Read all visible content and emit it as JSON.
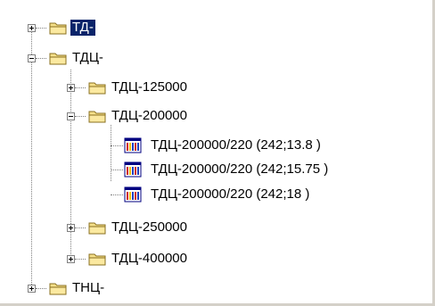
{
  "tree": {
    "items": [
      {
        "label": "ТД-",
        "icon": "folder-icon",
        "expanded": false,
        "selected": true
      },
      {
        "label": "ТДЦ-",
        "icon": "folder-icon",
        "expanded": true
      },
      {
        "label": "ТДЦ-125000",
        "icon": "folder-icon",
        "expanded": false
      },
      {
        "label": "ТДЦ-200000",
        "icon": "folder-icon",
        "expanded": true
      },
      {
        "label": "ТДЦ-200000/220 (242;13.8 )",
        "icon": "table-icon"
      },
      {
        "label": "ТДЦ-200000/220 (242;15.75 )",
        "icon": "table-icon"
      },
      {
        "label": "ТДЦ-200000/220 (242;18 )",
        "icon": "table-icon"
      },
      {
        "label": "ТДЦ-250000",
        "icon": "folder-icon",
        "expanded": false
      },
      {
        "label": "ТДЦ-400000",
        "icon": "folder-icon",
        "expanded": false
      },
      {
        "label": "ТНЦ-",
        "icon": "folder-icon",
        "expanded": false
      }
    ]
  },
  "colors": {
    "selection": "#0a246a",
    "folder": "#f5e08a",
    "background": "#ffffff"
  }
}
